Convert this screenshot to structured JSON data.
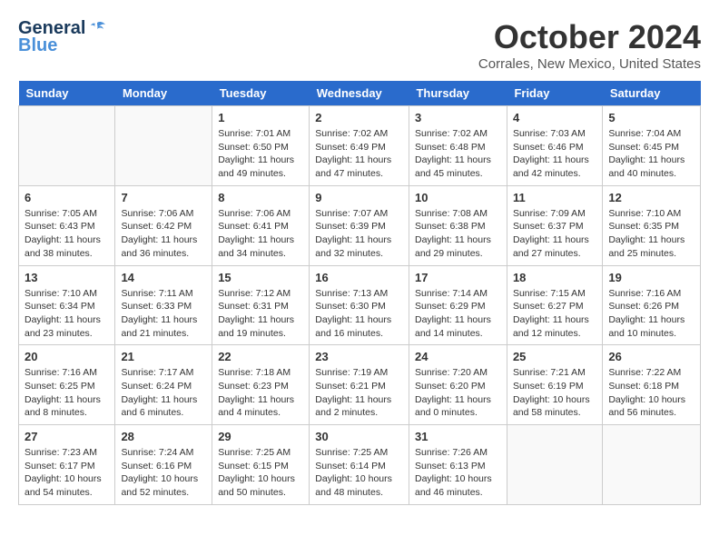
{
  "header": {
    "logo_general": "General",
    "logo_blue": "Blue",
    "month_title": "October 2024",
    "location": "Corrales, New Mexico, United States"
  },
  "days_of_week": [
    "Sunday",
    "Monday",
    "Tuesday",
    "Wednesday",
    "Thursday",
    "Friday",
    "Saturday"
  ],
  "weeks": [
    [
      {
        "day": "",
        "info": ""
      },
      {
        "day": "",
        "info": ""
      },
      {
        "day": "1",
        "info": "Sunrise: 7:01 AM\nSunset: 6:50 PM\nDaylight: 11 hours and 49 minutes."
      },
      {
        "day": "2",
        "info": "Sunrise: 7:02 AM\nSunset: 6:49 PM\nDaylight: 11 hours and 47 minutes."
      },
      {
        "day": "3",
        "info": "Sunrise: 7:02 AM\nSunset: 6:48 PM\nDaylight: 11 hours and 45 minutes."
      },
      {
        "day": "4",
        "info": "Sunrise: 7:03 AM\nSunset: 6:46 PM\nDaylight: 11 hours and 42 minutes."
      },
      {
        "day": "5",
        "info": "Sunrise: 7:04 AM\nSunset: 6:45 PM\nDaylight: 11 hours and 40 minutes."
      }
    ],
    [
      {
        "day": "6",
        "info": "Sunrise: 7:05 AM\nSunset: 6:43 PM\nDaylight: 11 hours and 38 minutes."
      },
      {
        "day": "7",
        "info": "Sunrise: 7:06 AM\nSunset: 6:42 PM\nDaylight: 11 hours and 36 minutes."
      },
      {
        "day": "8",
        "info": "Sunrise: 7:06 AM\nSunset: 6:41 PM\nDaylight: 11 hours and 34 minutes."
      },
      {
        "day": "9",
        "info": "Sunrise: 7:07 AM\nSunset: 6:39 PM\nDaylight: 11 hours and 32 minutes."
      },
      {
        "day": "10",
        "info": "Sunrise: 7:08 AM\nSunset: 6:38 PM\nDaylight: 11 hours and 29 minutes."
      },
      {
        "day": "11",
        "info": "Sunrise: 7:09 AM\nSunset: 6:37 PM\nDaylight: 11 hours and 27 minutes."
      },
      {
        "day": "12",
        "info": "Sunrise: 7:10 AM\nSunset: 6:35 PM\nDaylight: 11 hours and 25 minutes."
      }
    ],
    [
      {
        "day": "13",
        "info": "Sunrise: 7:10 AM\nSunset: 6:34 PM\nDaylight: 11 hours and 23 minutes."
      },
      {
        "day": "14",
        "info": "Sunrise: 7:11 AM\nSunset: 6:33 PM\nDaylight: 11 hours and 21 minutes."
      },
      {
        "day": "15",
        "info": "Sunrise: 7:12 AM\nSunset: 6:31 PM\nDaylight: 11 hours and 19 minutes."
      },
      {
        "day": "16",
        "info": "Sunrise: 7:13 AM\nSunset: 6:30 PM\nDaylight: 11 hours and 16 minutes."
      },
      {
        "day": "17",
        "info": "Sunrise: 7:14 AM\nSunset: 6:29 PM\nDaylight: 11 hours and 14 minutes."
      },
      {
        "day": "18",
        "info": "Sunrise: 7:15 AM\nSunset: 6:27 PM\nDaylight: 11 hours and 12 minutes."
      },
      {
        "day": "19",
        "info": "Sunrise: 7:16 AM\nSunset: 6:26 PM\nDaylight: 11 hours and 10 minutes."
      }
    ],
    [
      {
        "day": "20",
        "info": "Sunrise: 7:16 AM\nSunset: 6:25 PM\nDaylight: 11 hours and 8 minutes."
      },
      {
        "day": "21",
        "info": "Sunrise: 7:17 AM\nSunset: 6:24 PM\nDaylight: 11 hours and 6 minutes."
      },
      {
        "day": "22",
        "info": "Sunrise: 7:18 AM\nSunset: 6:23 PM\nDaylight: 11 hours and 4 minutes."
      },
      {
        "day": "23",
        "info": "Sunrise: 7:19 AM\nSunset: 6:21 PM\nDaylight: 11 hours and 2 minutes."
      },
      {
        "day": "24",
        "info": "Sunrise: 7:20 AM\nSunset: 6:20 PM\nDaylight: 11 hours and 0 minutes."
      },
      {
        "day": "25",
        "info": "Sunrise: 7:21 AM\nSunset: 6:19 PM\nDaylight: 10 hours and 58 minutes."
      },
      {
        "day": "26",
        "info": "Sunrise: 7:22 AM\nSunset: 6:18 PM\nDaylight: 10 hours and 56 minutes."
      }
    ],
    [
      {
        "day": "27",
        "info": "Sunrise: 7:23 AM\nSunset: 6:17 PM\nDaylight: 10 hours and 54 minutes."
      },
      {
        "day": "28",
        "info": "Sunrise: 7:24 AM\nSunset: 6:16 PM\nDaylight: 10 hours and 52 minutes."
      },
      {
        "day": "29",
        "info": "Sunrise: 7:25 AM\nSunset: 6:15 PM\nDaylight: 10 hours and 50 minutes."
      },
      {
        "day": "30",
        "info": "Sunrise: 7:25 AM\nSunset: 6:14 PM\nDaylight: 10 hours and 48 minutes."
      },
      {
        "day": "31",
        "info": "Sunrise: 7:26 AM\nSunset: 6:13 PM\nDaylight: 10 hours and 46 minutes."
      },
      {
        "day": "",
        "info": ""
      },
      {
        "day": "",
        "info": ""
      }
    ]
  ]
}
